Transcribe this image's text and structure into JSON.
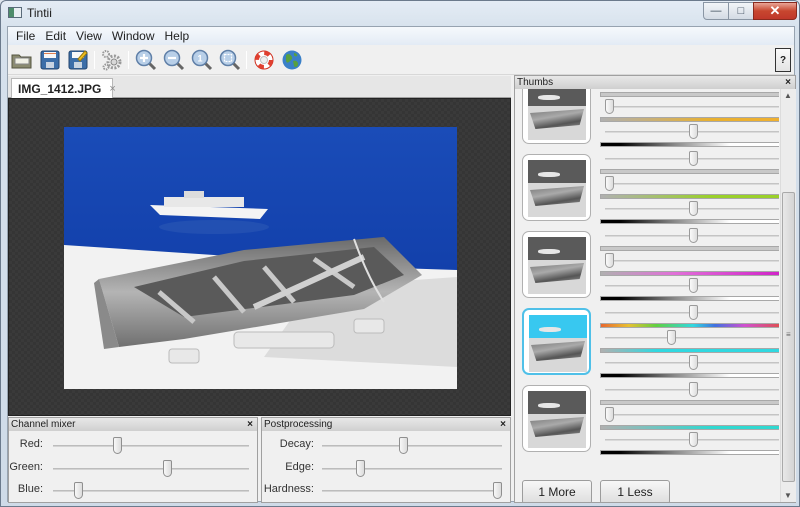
{
  "window": {
    "title": "Tintii",
    "controls": {
      "minimize": "—",
      "maximize": "□",
      "close": "✕"
    }
  },
  "menu": [
    "File",
    "Edit",
    "View",
    "Window",
    "Help"
  ],
  "toolbar": {
    "buttons": [
      {
        "name": "open-icon",
        "label": "Open"
      },
      {
        "name": "save-icon",
        "label": "Save"
      },
      {
        "name": "save-as-icon",
        "label": "Save As"
      },
      {
        "name": "settings-gear-icon",
        "label": "Settings"
      },
      {
        "name": "zoom-in-icon",
        "label": "Zoom In"
      },
      {
        "name": "zoom-out-icon",
        "label": "Zoom Out"
      },
      {
        "name": "zoom-actual-icon",
        "label": "Zoom 1:1"
      },
      {
        "name": "zoom-fit-icon",
        "label": "Zoom Fit"
      },
      {
        "name": "help-lifebuoy-icon",
        "label": "Help"
      },
      {
        "name": "website-globe-icon",
        "label": "Website"
      }
    ],
    "whats_this": "?"
  },
  "document": {
    "tab_label": "IMG_1412.JPG",
    "tab_close": "×"
  },
  "channel_mixer": {
    "title": "Channel mixer",
    "close": "×",
    "sliders": [
      {
        "label": "Red:",
        "value": 0.32
      },
      {
        "label": "Green:",
        "value": 0.59
      },
      {
        "label": "Blue:",
        "value": 0.11
      }
    ]
  },
  "postprocessing": {
    "title": "Postprocessing",
    "close": "×",
    "sliders": [
      {
        "label": "Decay:",
        "value": 0.45
      },
      {
        "label": "Edge:",
        "value": 0.2
      },
      {
        "label": "Hardness:",
        "value": 1.0
      }
    ]
  },
  "thumbs": {
    "title": "Thumbs",
    "close": "×",
    "items": [
      {
        "selected": false,
        "hue_slider": 0.5,
        "hue_color": "#e8b030",
        "hue_gradient": "linear-gradient(90deg,#b0b0b0,#e8b030 60%,#f0b030)",
        "sat_slider": 0.0,
        "val_slider": 0.5
      },
      {
        "selected": false,
        "hue_slider": 0.5,
        "hue_color": "#9ad02a",
        "hue_gradient": "linear-gradient(90deg,#b0b0b0,#9ad02a 60%,#9ad02a)",
        "sat_slider": 0.0,
        "val_slider": 0.5
      },
      {
        "selected": false,
        "hue_slider": 0.5,
        "hue_color": "#d020c8",
        "hue_gradient": "linear-gradient(90deg,#b0b0b0,#e070d8 40%,#d020c8)",
        "sat_slider": 0.0,
        "val_slider": 0.5
      },
      {
        "selected": true,
        "hue_slider": 0.5,
        "hue_color": "#30d8e0",
        "hue_gradient": "linear-gradient(90deg,#b0b0b0,#30d8e0 30%,#30d8e0)",
        "sat_slider": 0.37,
        "val_slider": 0.5
      },
      {
        "selected": false,
        "hue_slider": 0.5,
        "hue_color": "#30d8d0",
        "hue_gradient": "linear-gradient(90deg,#b0b0b0,#30d8d0 60%,#30d8d0)",
        "sat_slider": 0.0,
        "val_slider": 0.5
      }
    ],
    "more_button": "1 More",
    "less_button": "1 Less"
  }
}
